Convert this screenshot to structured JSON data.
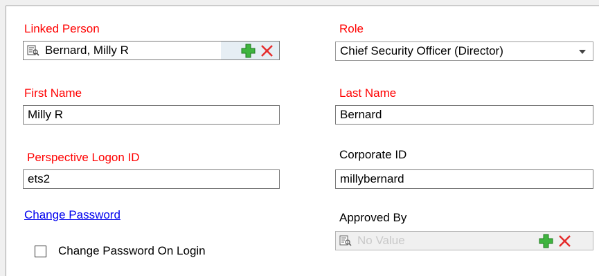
{
  "linked_person": {
    "label": "Linked Person",
    "value": "Bernard, Milly R"
  },
  "role": {
    "label": "Role",
    "value": "Chief Security Officer (Director)"
  },
  "first_name": {
    "label": "First Name",
    "value": "Milly R"
  },
  "last_name": {
    "label": "Last Name",
    "value": "Bernard"
  },
  "logon_id": {
    "label": "Perspective Logon ID",
    "value": "ets2"
  },
  "corporate_id": {
    "label": "Corporate ID",
    "value": "millybernard"
  },
  "change_password": {
    "link_label": "Change Password"
  },
  "change_password_on_login": {
    "label": "Change Password On Login",
    "checked": false
  },
  "approved_by": {
    "label": "Approved By",
    "placeholder": "No Value"
  },
  "icons": {
    "lookup": "lookup-icon",
    "add": "plus-icon",
    "clear": "close-icon"
  },
  "colors": {
    "required_label": "#ff0000",
    "link": "#0000ee",
    "add_green": "#3fb43f",
    "clear_red": "#e52b2b"
  }
}
